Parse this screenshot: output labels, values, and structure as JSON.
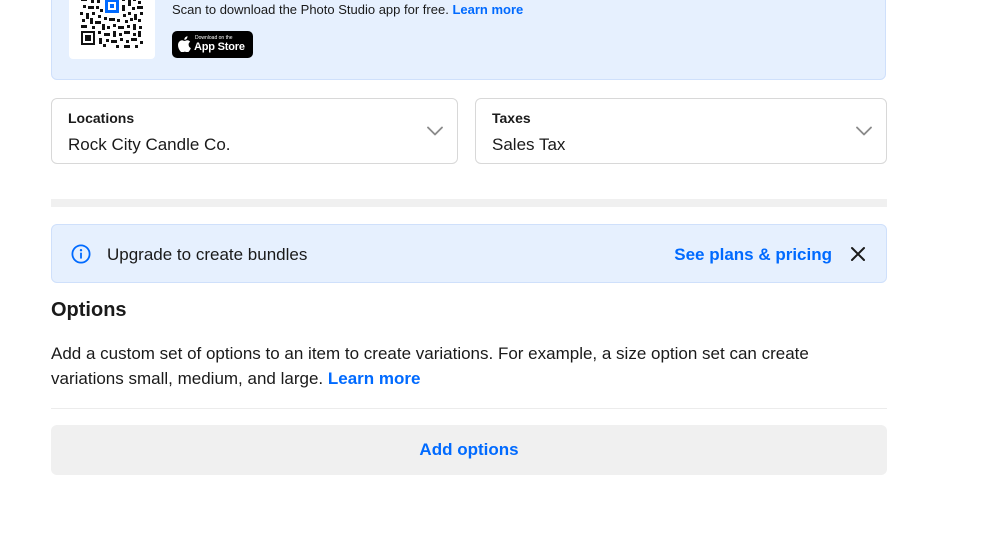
{
  "promo": {
    "text": "Scan to download the Photo Studio app for free.",
    "link": "Learn more",
    "appstore_small": "Download on the",
    "appstore_big": "App Store"
  },
  "locations": {
    "label": "Locations",
    "value": "Rock City Candle Co."
  },
  "taxes": {
    "label": "Taxes",
    "value": "Sales Tax"
  },
  "notice": {
    "message": "Upgrade to create bundles",
    "link": "See plans & pricing"
  },
  "options": {
    "title": "Options",
    "description": "Add a custom set of options to an item to create variations. For example, a size option set can create variations small, medium, and large.",
    "link": "Learn more",
    "button": "Add options"
  },
  "colors": {
    "accent": "#006aff",
    "banner_bg": "#e6f0fe",
    "neutral_bg": "#f0f0f0"
  },
  "icons": {
    "qr": "qr-code-icon",
    "apple": "apple-logo-icon",
    "chevron": "chevron-down-icon",
    "info": "info-icon",
    "close": "close-icon"
  }
}
